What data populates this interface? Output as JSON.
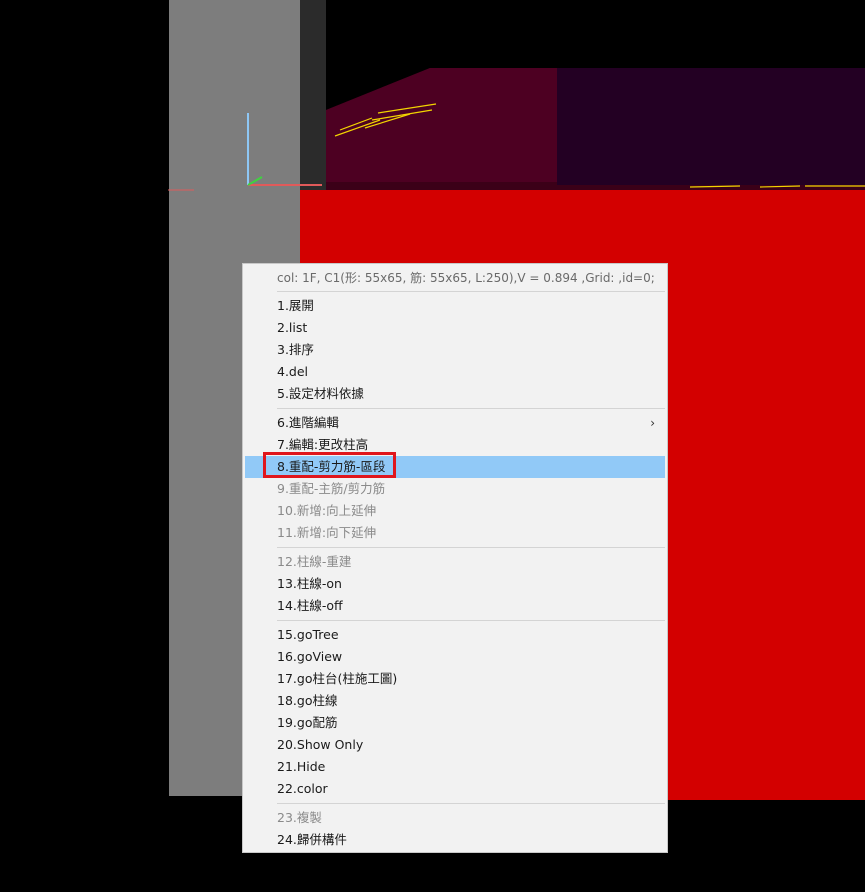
{
  "menu": {
    "header": "col: 1F, C1(形: 55x65, 筋: 55x65, L:250),V = 0.894 ,Grid: ,id=0;",
    "items": [
      {
        "label": "1.展開"
      },
      {
        "label": "2.list"
      },
      {
        "label": "3.排序"
      },
      {
        "label": "4.del"
      },
      {
        "label": "5.設定材料依據"
      },
      {
        "label": "6.進階編輯",
        "submenu_icon": "chevron-right-icon"
      },
      {
        "label": "7.編輯:更改柱高"
      },
      {
        "label": "8.重配-剪力筋-區段",
        "state": "highlighted"
      },
      {
        "label": "9.重配-主筋/剪力筋",
        "state": "disabled"
      },
      {
        "label": "10.新增:向上延伸",
        "state": "disabled"
      },
      {
        "label": "11.新增:向下延伸",
        "state": "disabled"
      },
      {
        "label": "12.柱線-重建",
        "state": "disabled"
      },
      {
        "label": "13.柱線-on"
      },
      {
        "label": "14.柱線-off"
      },
      {
        "label": "15.goTree"
      },
      {
        "label": "16.goView"
      },
      {
        "label": "17.go柱台(柱施工圖)"
      },
      {
        "label": "18.go柱線"
      },
      {
        "label": "19.go配筋"
      },
      {
        "label": "20.Show Only"
      },
      {
        "label": "21.Hide"
      },
      {
        "label": "22.color"
      },
      {
        "label": "23.複製",
        "state": "disabled"
      },
      {
        "label": "24.歸併構件"
      }
    ]
  },
  "colors": {
    "highlight": "#91c9f7",
    "annotation": "#e0161c",
    "model_red": "#d30000"
  }
}
